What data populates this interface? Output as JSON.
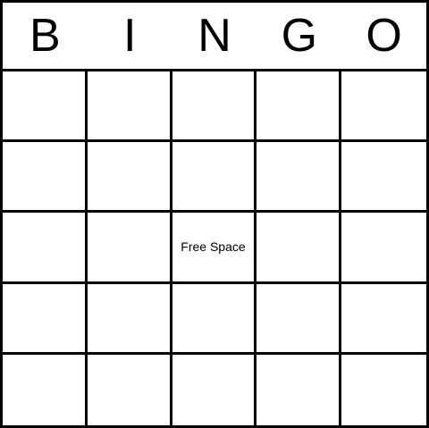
{
  "card": {
    "header_letters": [
      "B",
      "I",
      "N",
      "G",
      "O"
    ],
    "cells": [
      [
        "",
        "",
        "",
        "",
        ""
      ],
      [
        "",
        "",
        "",
        "",
        ""
      ],
      [
        "",
        "",
        "Free Space",
        "",
        ""
      ],
      [
        "",
        "",
        "",
        "",
        ""
      ],
      [
        "",
        "",
        "",
        "",
        ""
      ]
    ]
  }
}
